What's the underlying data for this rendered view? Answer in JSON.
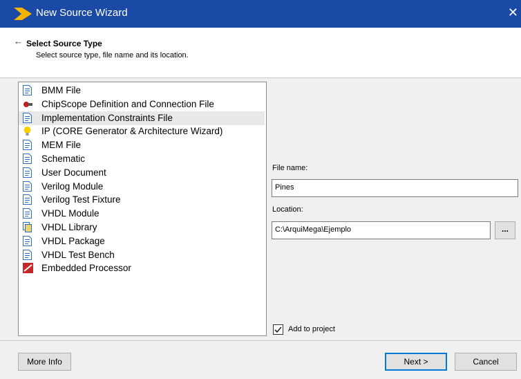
{
  "window": {
    "title": "New Source Wizard",
    "close_glyph": "✕"
  },
  "header": {
    "back_glyph": "←",
    "title": "Select Source Type",
    "subtitle": "Select source type, file name and its location."
  },
  "source_types": [
    {
      "label": "BMM File",
      "icon": "bmm-file-icon"
    },
    {
      "label": "ChipScope Definition and Connection File",
      "icon": "chipscope-icon"
    },
    {
      "label": "Implementation Constraints File",
      "icon": "constraints-file-icon",
      "selected": true
    },
    {
      "label": "IP (CORE Generator & Architecture Wizard)",
      "icon": "ip-core-icon"
    },
    {
      "label": "MEM File",
      "icon": "mem-file-icon"
    },
    {
      "label": "Schematic",
      "icon": "schematic-icon"
    },
    {
      "label": "User Document",
      "icon": "document-icon"
    },
    {
      "label": "Verilog Module",
      "icon": "verilog-module-icon"
    },
    {
      "label": "Verilog Test Fixture",
      "icon": "verilog-test-icon"
    },
    {
      "label": "VHDL Module",
      "icon": "vhdl-module-icon"
    },
    {
      "label": "VHDL Library",
      "icon": "vhdl-library-icon"
    },
    {
      "label": "VHDL Package",
      "icon": "vhdl-package-icon"
    },
    {
      "label": "VHDL Test Bench",
      "icon": "vhdl-testbench-icon"
    },
    {
      "label": "Embedded Processor",
      "icon": "embedded-processor-icon"
    }
  ],
  "form": {
    "file_name_label": "File name:",
    "file_name_value": "Pines",
    "location_label": "Location:",
    "location_value": "C:\\ArquiMega\\Ejemplo",
    "browse_label": "...",
    "add_to_project_label": "Add to project",
    "add_to_project_checked": true
  },
  "buttons": {
    "more_info": "More Info",
    "next": "Next >",
    "cancel": "Cancel"
  },
  "colors": {
    "title_bar": "#1a4aa5",
    "logo": "#f5b301",
    "selected_row": "#e8e8e8",
    "default_button_border": "#0078d7"
  }
}
